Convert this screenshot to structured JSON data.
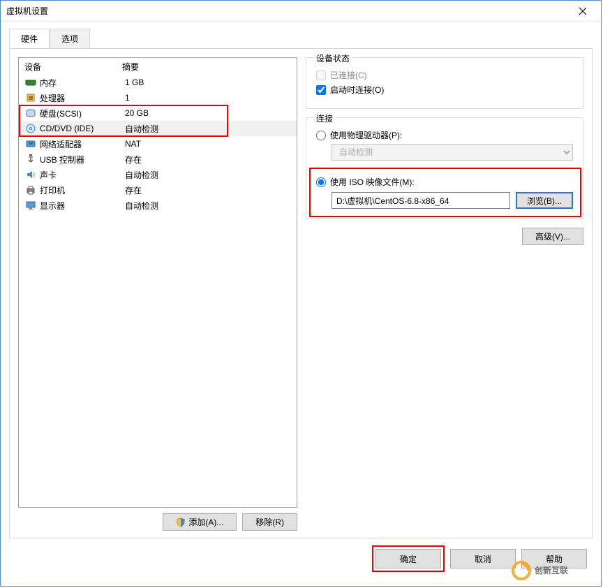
{
  "window": {
    "title": "虚拟机设置"
  },
  "tabs": {
    "hardware": "硬件",
    "options": "选项"
  },
  "columns": {
    "device": "设备",
    "summary": "摘要"
  },
  "hardware": [
    {
      "icon": "memory",
      "name": "内存",
      "summary": "1 GB"
    },
    {
      "icon": "cpu",
      "name": "处理器",
      "summary": "1"
    },
    {
      "icon": "disk",
      "name": "硬盘(SCSI)",
      "summary": "20 GB"
    },
    {
      "icon": "cd",
      "name": "CD/DVD (IDE)",
      "summary": "自动检测"
    },
    {
      "icon": "net",
      "name": "网络适配器",
      "summary": "NAT"
    },
    {
      "icon": "usb",
      "name": "USB 控制器",
      "summary": "存在"
    },
    {
      "icon": "sound",
      "name": "声卡",
      "summary": "自动检测"
    },
    {
      "icon": "printer",
      "name": "打印机",
      "summary": "存在"
    },
    {
      "icon": "display",
      "name": "显示器",
      "summary": "自动检测"
    }
  ],
  "buttons": {
    "add": "添加(A)...",
    "remove": "移除(R)",
    "browse": "浏览(B)...",
    "advanced": "高级(V)...",
    "ok": "确定",
    "cancel": "取消",
    "help": "帮助"
  },
  "device_status": {
    "title": "设备状态",
    "connected": "已连接(C)",
    "connect_power_on": "启动时连接(O)"
  },
  "connection": {
    "title": "连接",
    "physical": "使用物理驱动器(P):",
    "physical_value": "自动检测",
    "iso": "使用 ISO 映像文件(M):",
    "iso_path": "D:\\虚拟机\\CentOS-6.8-x86_64"
  },
  "watermark": "创新互联"
}
